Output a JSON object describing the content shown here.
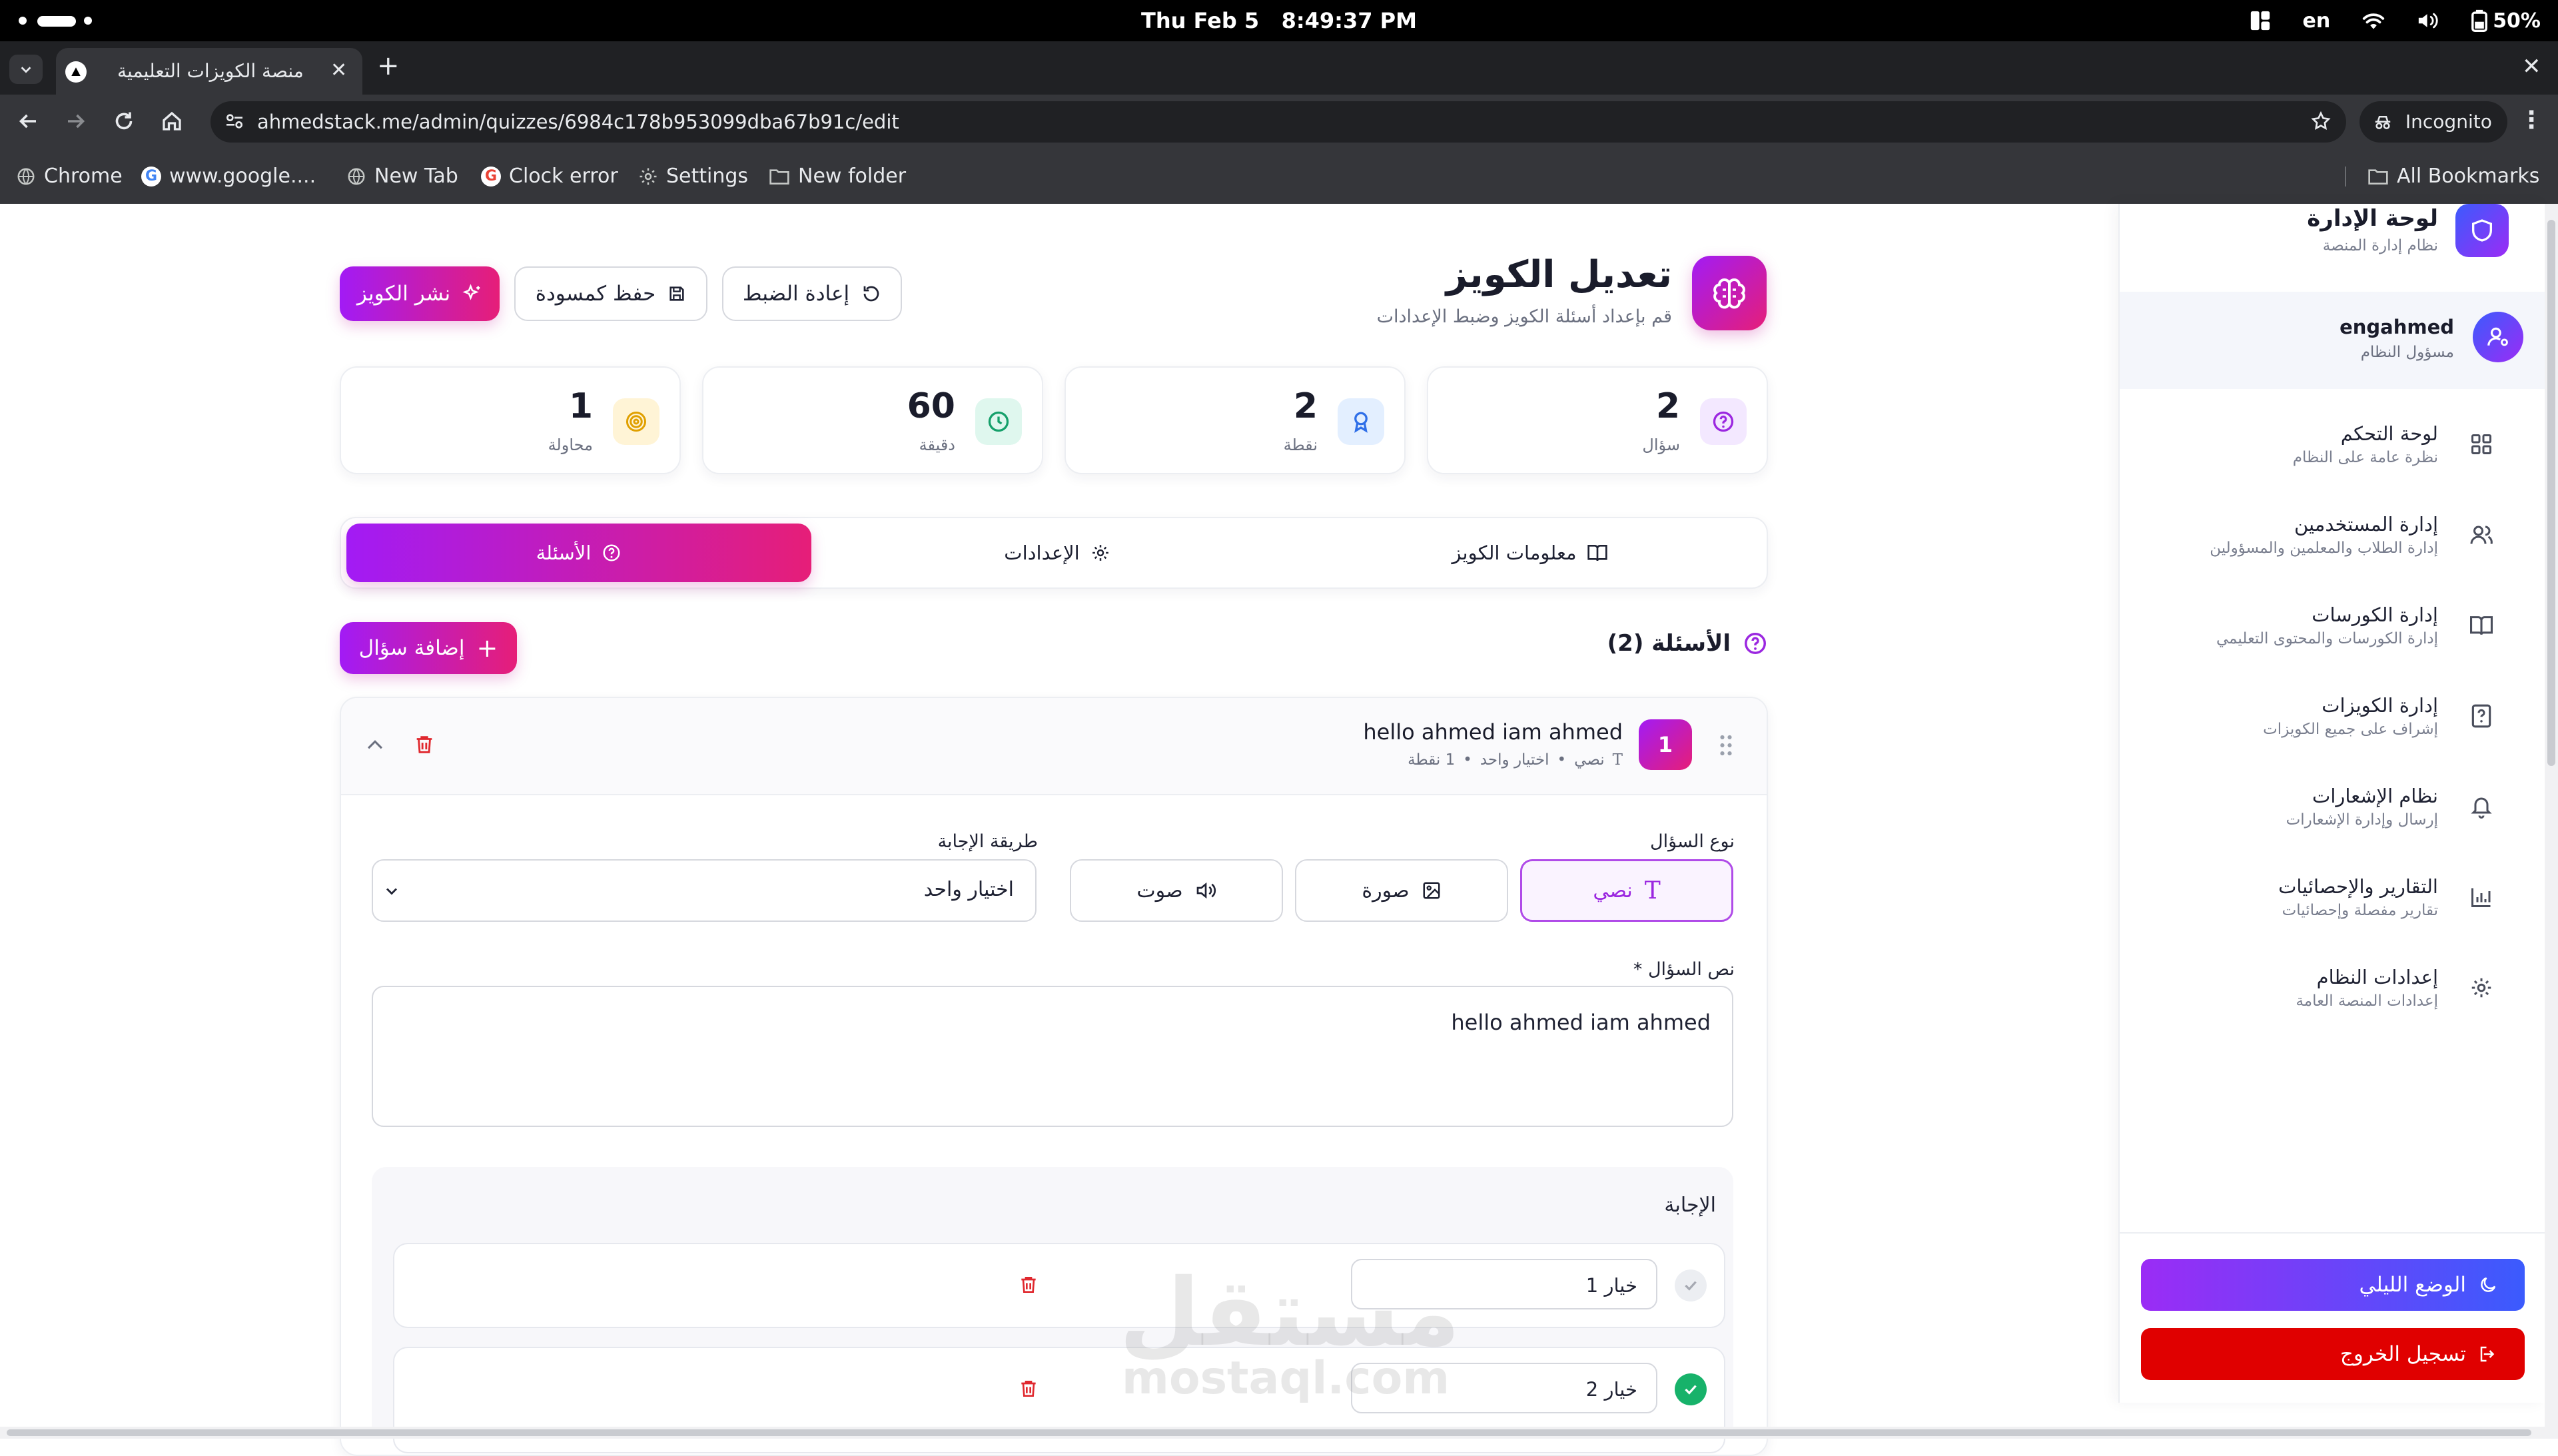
{
  "system": {
    "date": "Thu Feb 5",
    "time": "8:49:37 PM",
    "lang": "en",
    "battery": "50%"
  },
  "browser": {
    "tab_title": "منصة الكويزات التعليمية",
    "url": "ahmedstack.me/admin/quizzes/6984c178b953099dba67b91c/edit",
    "incognito_label": "Incognito",
    "bookmarks": [
      "Chrome",
      "www.google....",
      "New Tab",
      "Clock error",
      "Settings",
      "New folder"
    ],
    "all_bookmarks": "All Bookmarks"
  },
  "header": {
    "title": "تعديل الكويز",
    "subtitle": "قم بإعداد أسئلة الكويز وضبط الإعدادات",
    "reset_label": "إعادة الضبط",
    "draft_label": "حفظ كمسودة",
    "publish_label": "نشر الكويز"
  },
  "stats": [
    {
      "value": "2",
      "label": "سؤال"
    },
    {
      "value": "2",
      "label": "نقطة"
    },
    {
      "value": "60",
      "label": "دقيقة"
    },
    {
      "value": "1",
      "label": "محاولة"
    }
  ],
  "tabs": {
    "info": "معلومات الكويز",
    "settings": "الإعدادات",
    "questions": "الأسئلة"
  },
  "questions_section": {
    "title": "الأسئلة (2)",
    "add_label": "إضافة سؤال"
  },
  "question": {
    "number": "1",
    "title": "hello ahmed iam ahmed",
    "meta_type": "نصي",
    "meta_answer": "اختيار واحد",
    "meta_points": "1 نقطة",
    "type_label": "نوع السؤال",
    "types": [
      "نصي",
      "صورة",
      "صوت"
    ],
    "answer_method_label": "طريقة الإجابة",
    "answer_method_value": "اختيار واحد",
    "text_label": "نص السؤال *",
    "text_value": "hello ahmed iam ahmed",
    "answer_label": "الإجابة",
    "options": [
      {
        "value": "خيار 1",
        "correct": false
      },
      {
        "value": "خيار 2",
        "correct": true
      }
    ]
  },
  "sidebar": {
    "title": "لوحة الإدارة",
    "subtitle": "نظام إدارة المنصة",
    "user_name": "engahmed",
    "user_role": "مسؤول النظام",
    "items": [
      {
        "title": "لوحة التحكم",
        "sub": "نظرة عامة على النظام"
      },
      {
        "title": "إدارة المستخدمين",
        "sub": "إدارة الطلاب والمعلمين والمسؤولين"
      },
      {
        "title": "إدارة الكورسات",
        "sub": "إدارة الكورسات والمحتوى التعليمي"
      },
      {
        "title": "إدارة الكويزات",
        "sub": "إشراف على جميع الكويزات"
      },
      {
        "title": "نظام الإشعارات",
        "sub": "إرسال وإدارة الإشعارات"
      },
      {
        "title": "التقارير والإحصائيات",
        "sub": "تقارير مفصلة وإحصائيات"
      },
      {
        "title": "إعدادات النظام",
        "sub": "إعدادات المنصة العامة"
      }
    ],
    "dark_mode_label": "الوضع الليلي",
    "logout_label": "تسجيل الخروج"
  },
  "watermark": {
    "text": "مستقل",
    "domain": "mostaql.com"
  },
  "colors": {
    "accent_start": "#a21bf5",
    "accent_end": "#e61e78",
    "dark_mode_start": "#3b5bfd",
    "dark_mode_end": "#9b2cf5",
    "logout": "#e00000",
    "correct": "#17b26a",
    "danger": "#e0282e"
  }
}
